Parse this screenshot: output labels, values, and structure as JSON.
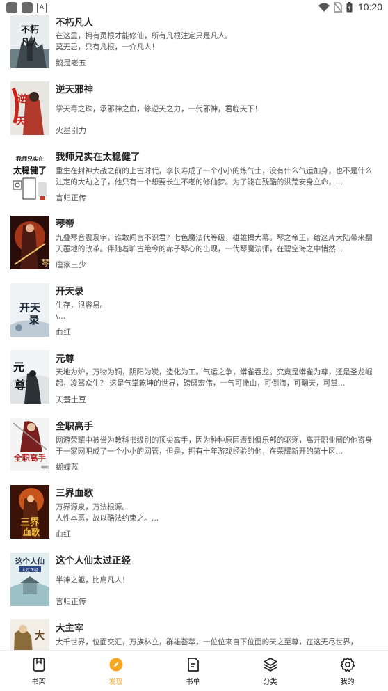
{
  "status_bar": {
    "time": "10:20"
  },
  "books": [
    {
      "title": "不朽凡人",
      "intro": "在这里，拥有灵根才能修仙，所有凡根注定只是凡人。\n    莫无忌，只有凡根，一介凡人！",
      "author": "鹅是老五",
      "cover_text": "不朽凡人"
    },
    {
      "title": "逆天邪神",
      "intro": "掌天毒之珠，承邪神之血，修逆天之力，一代邪神，君临天下！",
      "author": "火星引力",
      "cover_text": "逆天邪神"
    },
    {
      "title": "我师兄实在太稳健了",
      "intro": "重生在封神大战之前的上古时代，李长寿成了一个小小的炼气士，没有什么气运加身，也不是什么注定的大劫之子，他只有一个想要长生不老的修仙梦。为了能在残酷的洪荒安身立命，…",
      "author": "言归正传",
      "cover_text": "我师兄实在太稳健了"
    },
    {
      "title": "琴帝",
      "intro": "九叠琴音震寰宇，谁敢闻言不识君？七色魔法代等级，雄雄揭大幕。琴之帝王，给这片大陆带来翻天覆地的改革。伴随着旷古绝今的赤子琴心的出现，一代琴魔法师，在碧空海之中悄然…",
      "author": "唐家三少",
      "cover_text": "琴帝"
    },
    {
      "title": "开天录",
      "intro": "生存，很容易。\n\\…",
      "author": "血红",
      "cover_text": "开天录"
    },
    {
      "title": "元尊",
      "intro": "天地为炉，万物为铜，阴阳为炭，造化为工。气运之争，蟒雀吞龙。究竟是蟒雀为尊，还是圣龙崛起，凌驾众生？ 这是气掌乾坤的世界，磅礴宏伟，一气可撒山，可倒海，可翻天，可掌…",
      "author": "天蚕土豆",
      "cover_text": "元尊"
    },
    {
      "title": "全职高手",
      "intro": "网游荣耀中被誉为教科书级别的顶尖高手，因为种种原因遭到俱乐部的驱逐，离开职业圈的他寄身于一家网吧成了一个小小的网管，但是，拥有十年游戏经验的他，在荣耀新开的第十区…",
      "author": "蝴蝶蓝",
      "cover_text": "全职高手"
    },
    {
      "title": "三界血歌",
      "intro": "万界源泉，万法根源。\n    人性本恶，故以酷法约束之。…",
      "author": "血红",
      "cover_text": "三界血歌"
    },
    {
      "title": "这个人仙太过正经",
      "intro": "半神之躯，比肩凡人！",
      "author": "言归正传",
      "cover_text": "这个人仙太过正经"
    },
    {
      "title": "大主宰",
      "intro": "大千世界，位面交汇，万族林立，群雄荟萃，一位位来自下位面的天之至尊，在这无尽世界，",
      "author": "",
      "cover_text": "大主宰"
    }
  ],
  "nav": {
    "tabs": [
      {
        "label": "书架",
        "icon": "bookshelf-icon"
      },
      {
        "label": "发现",
        "icon": "compass-icon"
      },
      {
        "label": "书单",
        "icon": "booklist-icon"
      },
      {
        "label": "分类",
        "icon": "layers-icon"
      },
      {
        "label": "我的",
        "icon": "gear-icon"
      }
    ],
    "active_index": 1,
    "active_color": "#f5a623"
  }
}
